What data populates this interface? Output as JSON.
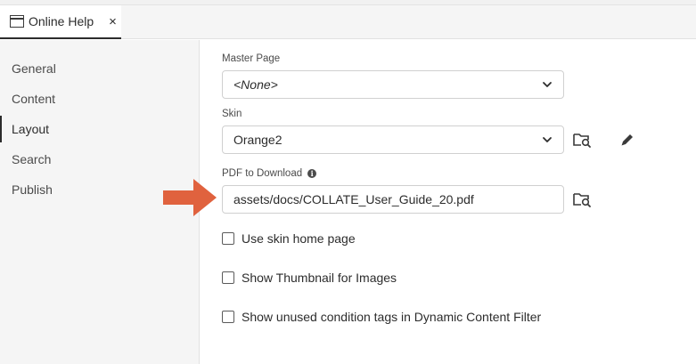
{
  "tab": {
    "label": "Online Help",
    "close": "×"
  },
  "sidebar": {
    "items": [
      {
        "label": "General"
      },
      {
        "label": "Content"
      },
      {
        "label": "Layout",
        "active": true
      },
      {
        "label": "Search"
      },
      {
        "label": "Publish"
      }
    ]
  },
  "form": {
    "master_page": {
      "label": "Master Page",
      "value": "<None>"
    },
    "skin": {
      "label": "Skin",
      "value": "Orange2"
    },
    "pdf": {
      "label": "PDF to Download",
      "value": "assets/docs/COLLATE_User_Guide_20.pdf"
    },
    "checkboxes": [
      {
        "label": "Use skin home page",
        "checked": false
      },
      {
        "label": "Show Thumbnail for Images",
        "checked": false
      },
      {
        "label": "Show unused condition tags in Dynamic Content Filter",
        "checked": false
      }
    ]
  },
  "icons": {
    "tab": "window-icon",
    "browse": "folder-search-icon",
    "edit": "pencil-icon",
    "info": "info-icon",
    "annotation": "arrow-right-icon"
  },
  "colors": {
    "annotation_arrow": "#e0623e",
    "text": "#2c2c2c",
    "sidebar_bg": "#f5f5f5"
  }
}
